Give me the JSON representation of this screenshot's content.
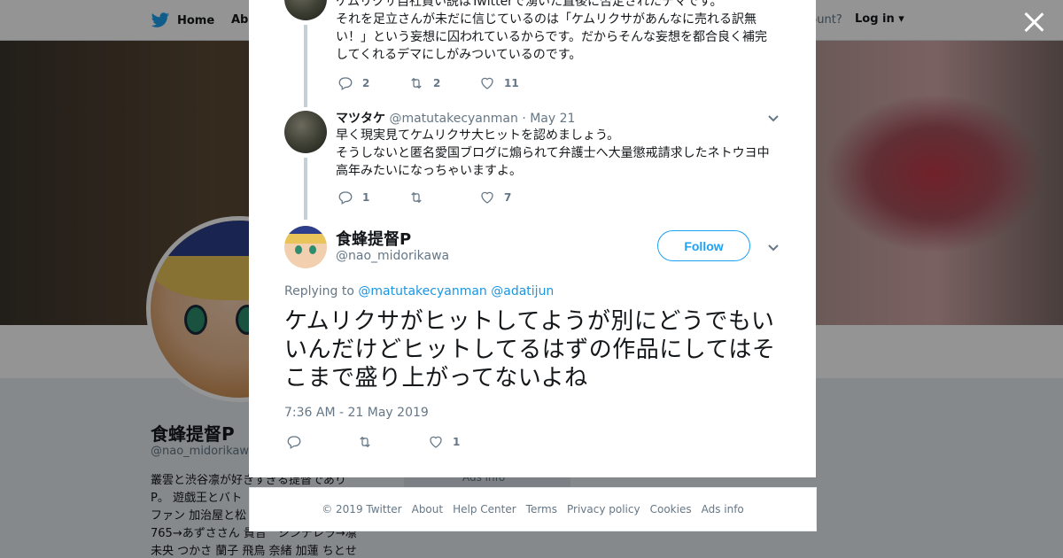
{
  "topbar": {
    "home_label": "Home",
    "about_label": "Abo",
    "account_prompt": "ccount?",
    "login_label": "Log in"
  },
  "profile": {
    "name": "食蜂提督P",
    "handle": "@nao_midorikawa",
    "bio_lines": [
      "叢雲と渋谷凛が好きすぎる提督であり",
      "P。 遊戯王とバト",
      "ファン 加治屋と松",
      "765→あずささん 貴音　シンデレラ→凛",
      "未央 つかさ 蘭子 飛鳥 奈緒 加蓮 ちとせ"
    ],
    "side_card_text": "Ads info"
  },
  "thread": {
    "tweet1": {
      "text_lines": [
        "ケムリクサ自社買い説はTwitterで湧いた直後に否定されたデマです。",
        "それを足立さんが未だに信じているのは「ケムリクサがあんなに売れる訳無",
        "い！」という妄想に囚われているからです。だからそんな妄想を都合良く補完",
        "してくれるデマにしがみついているのです。"
      ],
      "replies": "2",
      "retweets": "2",
      "likes": "11"
    },
    "tweet2": {
      "name": "マツタケ",
      "handle": "@matutakecyanman",
      "date": "May 21",
      "text_lines": [
        "早く現実見てケムリクサ大ヒットを認めましょう。",
        "そうしないと匿名愛国ブログに煽られて弁護士へ大量懲戒請求したネトウヨ中",
        "高年みたいになっちゃいますよ。"
      ],
      "replies": "1",
      "retweets": "",
      "likes": "7"
    }
  },
  "main_tweet": {
    "name": "食蜂提督P",
    "handle": "@nao_midorikawa",
    "follow_label": "Follow",
    "replying_prefix": "Replying to",
    "reply_to_1": "@matutakecyanman",
    "reply_to_2": "@adatijun",
    "text": "ケムリクサがヒットしてようが別にどうでもいいんだけどヒットしてるはずの作品にしてはそこまで盛り上がってないよね",
    "timestamp": "7:36 AM - 21 May 2019",
    "replies": "",
    "retweets": "",
    "likes": "1"
  },
  "footer": {
    "copyright": "© 2019 Twitter",
    "links": [
      "About",
      "Help Center",
      "Terms",
      "Privacy policy",
      "Cookies",
      "Ads info"
    ]
  },
  "colors": {
    "brand_blue": "#1da1f2",
    "link_blue": "#1b95e0",
    "muted_gray": "#657786",
    "thread_line": "#c4cfd6"
  },
  "icons": [
    "bird-icon",
    "close-icon",
    "reply-icon",
    "retweet-icon",
    "like-icon",
    "chevron-down-icon"
  ]
}
